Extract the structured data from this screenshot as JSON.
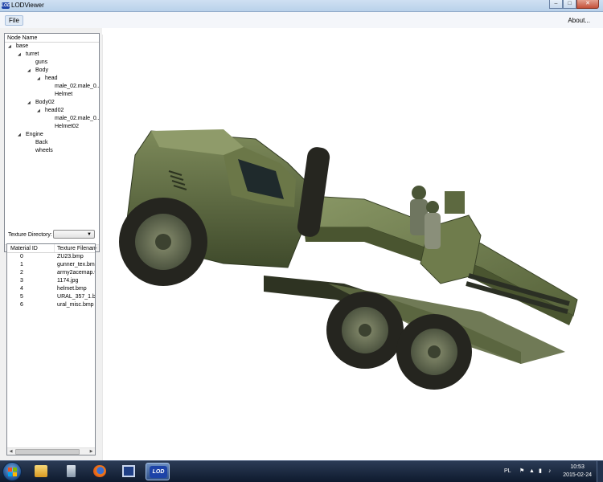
{
  "window": {
    "title": "LODViewer",
    "icon_text": "LOD"
  },
  "menu": {
    "file": "File",
    "about": "About..."
  },
  "tree": {
    "header": "Node Name",
    "nodes": [
      {
        "label": "base",
        "depth": 0,
        "expanded": true
      },
      {
        "label": "turret",
        "depth": 1,
        "expanded": true
      },
      {
        "label": "guns",
        "depth": 2
      },
      {
        "label": "Body",
        "depth": 2,
        "expanded": true
      },
      {
        "label": "head",
        "depth": 3,
        "expanded": true
      },
      {
        "label": "male_02.male_0...",
        "depth": 4
      },
      {
        "label": "Helmet",
        "depth": 4
      },
      {
        "label": "Body02",
        "depth": 2,
        "expanded": true
      },
      {
        "label": "head02",
        "depth": 3,
        "expanded": true
      },
      {
        "label": "male_02.male_0...",
        "depth": 4
      },
      {
        "label": "Helmet02",
        "depth": 4
      },
      {
        "label": "Engine",
        "depth": 1,
        "expanded": true
      },
      {
        "label": "Back",
        "depth": 2
      },
      {
        "label": "wheels",
        "depth": 2
      }
    ]
  },
  "texture_directory": {
    "label": "Texture Directory:",
    "value": ""
  },
  "materials": {
    "headers": [
      "Material ID",
      "Texture Filenam"
    ],
    "rows": [
      [
        "0",
        "ZU23.bmp"
      ],
      [
        "1",
        "gunner_tex.bm"
      ],
      [
        "2",
        "army2acemap.t"
      ],
      [
        "3",
        "1174.jpg"
      ],
      [
        "4",
        "helmet.bmp"
      ],
      [
        "5",
        "URAL_357_1.bm"
      ],
      [
        "6",
        "ural_misc.bmp"
      ]
    ]
  },
  "taskbar": {
    "language": "PL",
    "time": "10:53",
    "date": "2015-02-24",
    "items": [
      "explorer-icon",
      "calculator-icon",
      "firefox-icon",
      "floppy-app-icon",
      "lodviewer-icon"
    ],
    "active_item": "lodviewer-icon",
    "lod_label": "LOD"
  },
  "colors": {
    "truck_body": "#5a6a3c",
    "truck_dark": "#3e4a2a",
    "tire": "#2a2a22",
    "hub": "#6b7358",
    "soldier": "#4f5a3a"
  }
}
